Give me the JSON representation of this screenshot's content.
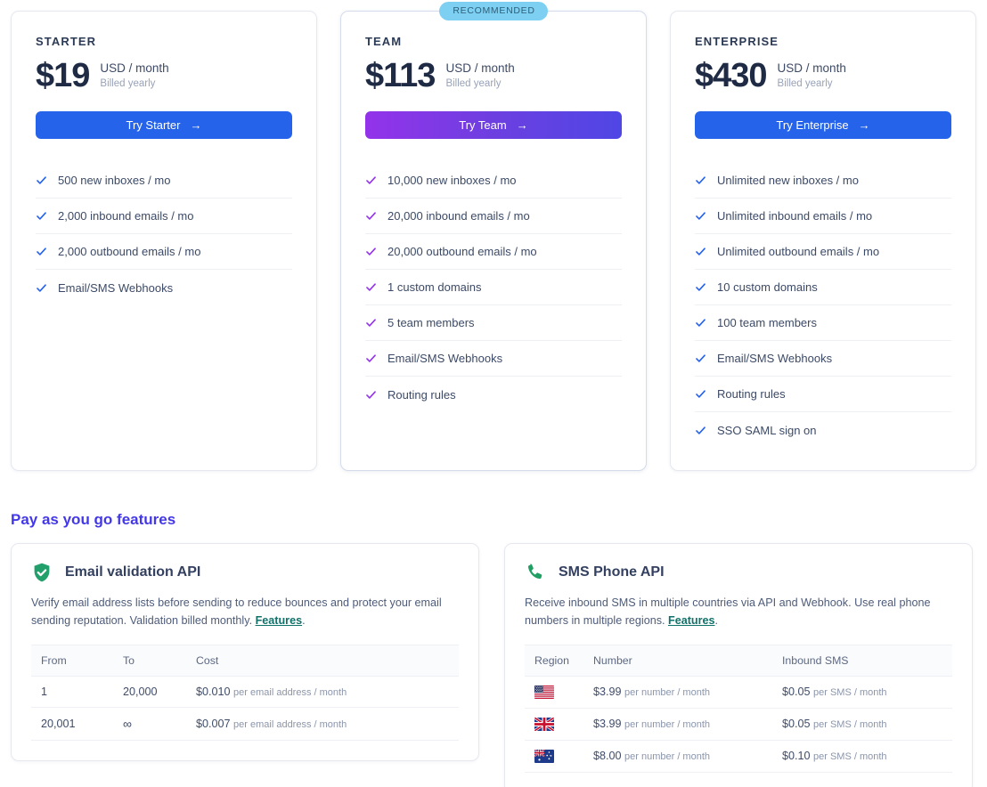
{
  "plans": [
    {
      "name": "STARTER",
      "price": "$19",
      "unit": "USD / month",
      "billed": "Billed yearly",
      "cta": "Try Starter",
      "arrow": "→",
      "accent": "#2563eb",
      "recommended": false,
      "badge": "",
      "features": [
        "500 new inboxes / mo",
        "2,000 inbound emails / mo",
        "2,000 outbound emails / mo",
        "Email/SMS Webhooks"
      ]
    },
    {
      "name": "TEAM",
      "price": "$113",
      "unit": "USD / month",
      "billed": "Billed yearly",
      "cta": "Try Team",
      "arrow": "→",
      "accent": "#9333ea",
      "recommended": true,
      "badge": "RECOMMENDED",
      "features": [
        "10,000 new inboxes / mo",
        "20,000 inbound emails / mo",
        "20,000 outbound emails / mo",
        "1 custom domains",
        "5 team members",
        "Email/SMS Webhooks",
        "Routing rules"
      ]
    },
    {
      "name": "ENTERPRISE",
      "price": "$430",
      "unit": "USD / month",
      "billed": "Billed yearly",
      "cta": "Try Enterprise",
      "arrow": "→",
      "accent": "#2563eb",
      "recommended": false,
      "badge": "",
      "features": [
        "Unlimited new inboxes / mo",
        "Unlimited inbound emails / mo",
        "Unlimited outbound emails / mo",
        "10 custom domains",
        "100 team members",
        "Email/SMS Webhooks",
        "Routing rules",
        "SSO SAML sign on"
      ]
    }
  ],
  "payg": {
    "title": "Pay as you go features",
    "email_api": {
      "icon": "shield-check-icon",
      "title": "Email validation API",
      "desc_before": "Verify email address lists before sending to reduce bounces and protect your email sending reputation. Validation billed monthly. ",
      "link": "Features",
      "desc_after": ".",
      "columns": [
        "From",
        "To",
        "Cost"
      ],
      "rows": [
        {
          "from": "1",
          "to": "20,000",
          "cost": "$0.010",
          "cost_unit": "per email address / month"
        },
        {
          "from": "20,001",
          "to": "∞",
          "cost": "$0.007",
          "cost_unit": "per email address / month"
        }
      ]
    },
    "sms_api": {
      "icon": "phone-icon",
      "title": "SMS Phone API",
      "desc_before": "Receive inbound SMS in multiple countries via API and Webhook. Use real phone numbers in multiple regions. ",
      "link": "Features",
      "desc_after": ".",
      "columns": [
        "Region",
        "Number",
        "Inbound SMS"
      ],
      "rows": [
        {
          "flag": "us-flag",
          "number": "$3.99",
          "number_unit": "per number / month",
          "sms": "$0.05",
          "sms_unit": "per SMS / month"
        },
        {
          "flag": "uk-flag",
          "number": "$3.99",
          "number_unit": "per number / month",
          "sms": "$0.05",
          "sms_unit": "per SMS / month"
        },
        {
          "flag": "au-flag",
          "number": "$8.00",
          "number_unit": "per number / month",
          "sms": "$0.10",
          "sms_unit": "per SMS / month"
        }
      ]
    }
  },
  "colors": {
    "blue": "#2563eb",
    "purple": "#9333ea",
    "badge_bg": "#7ed0f2",
    "heading": "#4338e8",
    "green": "#22a06b",
    "link": "#11726a"
  }
}
